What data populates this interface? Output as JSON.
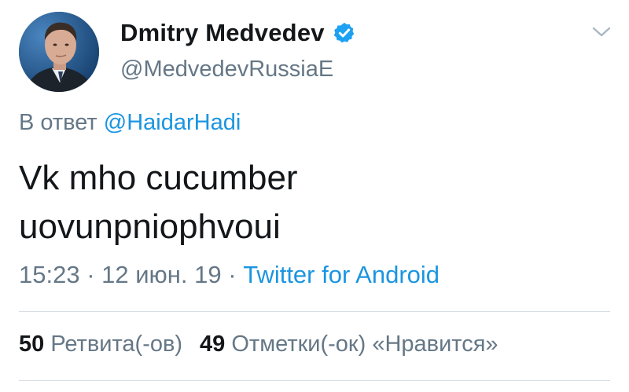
{
  "author": {
    "display_name": "Dmitry Medvedev",
    "handle": "@MedvedevRussiaE",
    "verified": true,
    "avatar_icon": "profile-photo"
  },
  "reply": {
    "prefix": "В ответ",
    "mention": "@HaidarHadi"
  },
  "tweet": {
    "text_line1": "Vk mho cucumber",
    "text_line2": "uovunpniophvoui"
  },
  "meta": {
    "time": "15:23",
    "separator1": " · ",
    "date": "12 июн. 19",
    "separator2": " · ",
    "source": "Twitter for Android"
  },
  "stats": {
    "retweets_count": "50",
    "retweets_label": "Ретвита(-ов)",
    "likes_count": "49",
    "likes_label": "Отметки(-ок) «Нравится»"
  },
  "colors": {
    "link": "#1b95e0",
    "secondary": "#657786",
    "primary": "#14171a",
    "verified": "#1da1f2"
  },
  "icons": {
    "verified": "verified-badge-icon",
    "menu": "chevron-down-icon"
  }
}
